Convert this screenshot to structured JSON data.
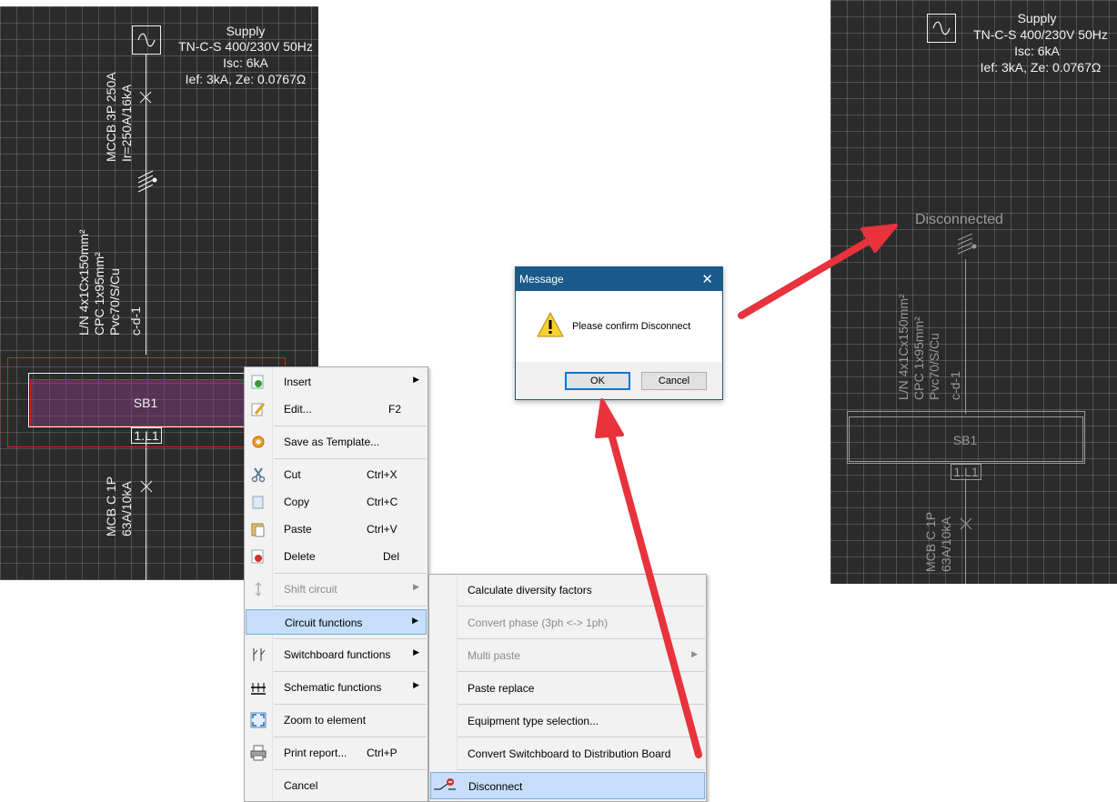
{
  "supply": {
    "label": "Supply",
    "system": "TN-C-S 400/230V 50Hz",
    "isc": "Isc: 6kA",
    "ief": "Ief: 3kA, Ze: 0.0767Ω"
  },
  "left_diagram": {
    "breaker_line1": "MCCB 3P 250A",
    "breaker_line2": "Ir=250A/16kA",
    "cable_line1": "L/N 4x1Cx150mm²",
    "cable_line2": "CPC 1x95mm²",
    "cable_line3": "Pvc70/S/Cu",
    "cable_line4": "c-d-1",
    "board_label": "SB1",
    "board_tag": "1.L1",
    "mcb_line1": "MCB C 1P",
    "mcb_line2": "63A/10kA"
  },
  "right_diagram": {
    "disconnected_label": "Disconnected",
    "cable_line1": "L/N 4x1Cx150mm²",
    "cable_line2": "CPC 1x95mm²",
    "cable_line3": "Pvc70/S/Cu",
    "cable_line4": "c-d-1",
    "board_label": "SB1",
    "board_tag": "1.L1",
    "mcb_line1": "MCB C 1P",
    "mcb_line2": "63A/10kA"
  },
  "context_menu": {
    "items": [
      {
        "label": "Insert",
        "shortcut": "",
        "arrow": "▶",
        "icon": "insert-icon"
      },
      {
        "label": "Edit...",
        "shortcut": "F2",
        "arrow": "",
        "icon": "edit-icon"
      },
      {
        "label": "Save as Template...",
        "shortcut": "",
        "arrow": "",
        "icon": "template-icon"
      },
      {
        "label": "Cut",
        "shortcut": "Ctrl+X",
        "arrow": "",
        "icon": "scissors-icon"
      },
      {
        "label": "Copy",
        "shortcut": "Ctrl+C",
        "arrow": "",
        "icon": "copy-icon"
      },
      {
        "label": "Paste",
        "shortcut": "Ctrl+V",
        "arrow": "",
        "icon": "paste-icon"
      },
      {
        "label": "Delete",
        "shortcut": "Del",
        "arrow": "",
        "icon": "delete-icon"
      },
      {
        "label": "Shift circuit",
        "shortcut": "",
        "arrow": "▶",
        "icon": "shift-icon"
      },
      {
        "label": "Circuit functions",
        "shortcut": "",
        "arrow": "▶",
        "icon": ""
      },
      {
        "label": "Switchboard functions",
        "shortcut": "",
        "arrow": "▶",
        "icon": "switchboard-icon"
      },
      {
        "label": "Schematic functions",
        "shortcut": "",
        "arrow": "▶",
        "icon": "schematic-icon"
      },
      {
        "label": "Zoom to element",
        "shortcut": "",
        "arrow": "",
        "icon": "zoom-icon"
      },
      {
        "label": "Print report...",
        "shortcut": "Ctrl+P",
        "arrow": "",
        "icon": "printer-icon"
      },
      {
        "label": "Cancel",
        "shortcut": "",
        "arrow": "",
        "icon": ""
      }
    ]
  },
  "submenu": {
    "items": [
      {
        "label": "Calculate diversity factors"
      },
      {
        "label": "Convert phase (3ph <-> 1ph)"
      },
      {
        "label": "Multi paste",
        "arrow": "▶"
      },
      {
        "label": "Paste replace"
      },
      {
        "label": "Equipment type selection..."
      },
      {
        "label": "Convert Switchboard to Distribution Board"
      },
      {
        "label": "Disconnect",
        "icon": "disconnect-icon"
      }
    ]
  },
  "dialog": {
    "title": "Message",
    "close": "✕",
    "message": "Please confirm Disconnect",
    "ok": "OK",
    "cancel": "Cancel"
  },
  "colors": {
    "canvas": "#2b2b2b",
    "highlight": "#c6defa",
    "arrow": "#e8323c",
    "dialog_title": "#1a5a8a",
    "selection": "#e02020"
  }
}
